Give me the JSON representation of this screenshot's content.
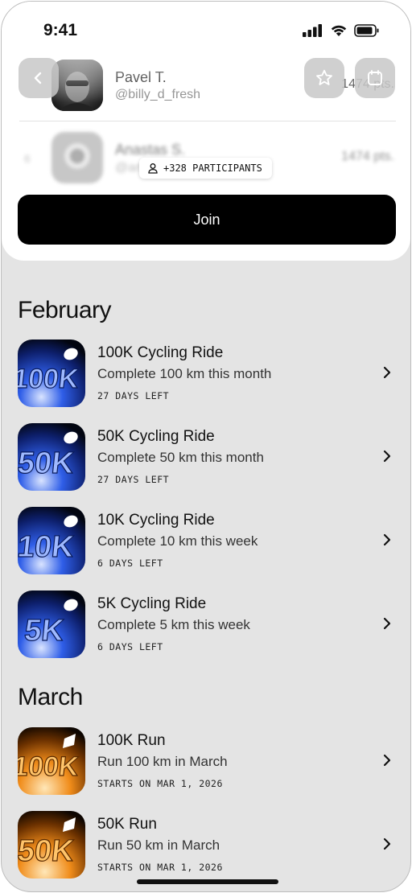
{
  "status_bar": {
    "time": "9:41"
  },
  "leaderboard": [
    {
      "name": "Pavel T.",
      "handle": "@billy_d_fresh",
      "points": "1474 pts."
    },
    {
      "rank": "6",
      "name": "Anastas S.",
      "handle": "@anastas",
      "points": "1474 pts."
    }
  ],
  "participants_label": "+328 PARTICIPANTS",
  "join_label": "Join",
  "sections": [
    {
      "title": "February",
      "items": [
        {
          "badge": "100K",
          "title": "100K Cycling Ride",
          "subtitle": "Complete 100 km this month",
          "meta": "27 DAYS LEFT"
        },
        {
          "badge": "50K",
          "title": "50K Cycling Ride",
          "subtitle": "Complete 50 km this month",
          "meta": "27 DAYS LEFT"
        },
        {
          "badge": "10K",
          "title": "10K Cycling Ride",
          "subtitle": "Complete 10 km this week",
          "meta": "6 DAYS LEFT"
        },
        {
          "badge": "5K",
          "title": "5K Cycling Ride",
          "subtitle": "Complete 5 km this week",
          "meta": "6 DAYS LEFT"
        }
      ]
    },
    {
      "title": "March",
      "items": [
        {
          "badge": "100K",
          "title": "100K Run",
          "subtitle": "Run 100 km in March",
          "meta": "STARTS ON MAR 1, 2026"
        },
        {
          "badge": "50K",
          "title": "50K Run",
          "subtitle": "Run 50 km in March",
          "meta": "STARTS ON MAR 1, 2026"
        }
      ]
    }
  ],
  "colors": {
    "cycling_badge": "#1f4fd6",
    "run_badge": "#f08c1a",
    "join_button": "#000000",
    "background": "#e4e4e4"
  },
  "icons": {
    "back": "chevron-left-icon",
    "favorite": "star-icon",
    "calendar": "calendar-icon",
    "participants": "user-icon",
    "item_chevron": "chevron-right-icon"
  }
}
